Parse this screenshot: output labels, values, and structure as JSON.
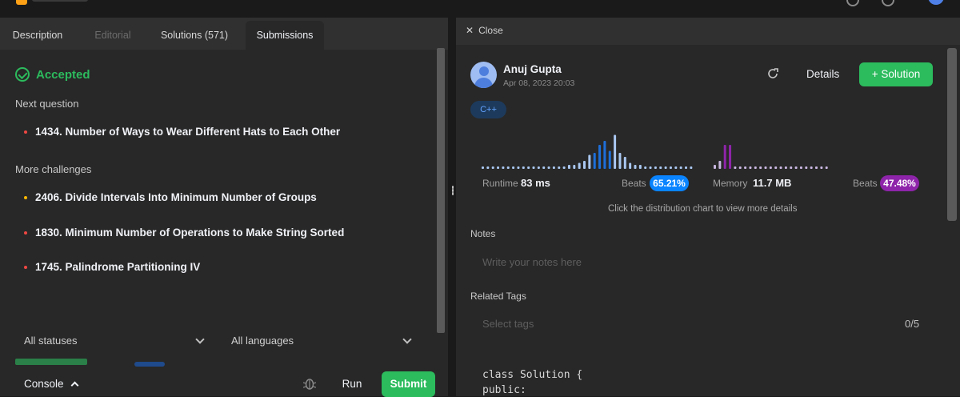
{
  "tabs": [
    {
      "label": "Description"
    },
    {
      "label": "Editorial"
    },
    {
      "label": "Solutions (571)"
    },
    {
      "label": "Submissions"
    }
  ],
  "result": {
    "status": "Accepted"
  },
  "next_question": {
    "title": "Next question",
    "item": {
      "label": "1434. Number of Ways to Wear Different Hats to Each Other",
      "color": "#ef4743"
    }
  },
  "more_challenges": {
    "title": "More challenges",
    "items": [
      {
        "label": "2406. Divide Intervals Into Minimum Number of Groups",
        "color": "#ffb800"
      },
      {
        "label": "1830. Minimum Number of Operations to Make String Sorted",
        "color": "#ef4743"
      },
      {
        "label": "1745. Palindrome Partitioning IV",
        "color": "#ef4743"
      }
    ]
  },
  "filters": {
    "status": "All statuses",
    "language": "All languages"
  },
  "console": {
    "label": "Console",
    "run": "Run",
    "submit": "Submit"
  },
  "detail": {
    "close": "Close",
    "user": "Anuj Gupta",
    "date": "Apr 08, 2023 20:03",
    "details_label": "Details",
    "solution_label": "Solution",
    "language": "C++",
    "runtime": {
      "label": "Runtime",
      "value": "83 ms",
      "beats_label": "Beats",
      "beats": "65.21%"
    },
    "memory": {
      "label": "Memory",
      "value": "11.7 MB",
      "beats_label": "Beats",
      "beats": "47.48%"
    },
    "hint": "Click the distribution chart to view more details",
    "notes_title": "Notes",
    "notes_placeholder": "Write your notes here",
    "tags_title": "Related Tags",
    "tags_placeholder": "Select tags",
    "tags_count": "0/5",
    "code": [
      "class Solution {",
      "public:"
    ]
  },
  "colors": {
    "accent_green": "#2cbb5d",
    "runtime_blue": "#0a84ff",
    "memory_purple": "#8e24aa"
  },
  "chart_data": [
    {
      "type": "bar",
      "title": "",
      "values": [
        1,
        1,
        1,
        1,
        1,
        1,
        1,
        1,
        1,
        1,
        1,
        1,
        1,
        1,
        1,
        1,
        1,
        2,
        2,
        3,
        4,
        7,
        8,
        12,
        14,
        9,
        17,
        8,
        6,
        3,
        2,
        2,
        1,
        1,
        1,
        1,
        1,
        1,
        1,
        1,
        1,
        1
      ],
      "highlight_range": [
        22,
        25
      ],
      "color": "#a9c7f0",
      "highlight_color": "#1e6fd9"
    },
    {
      "type": "bar",
      "title": "",
      "values": [
        2,
        4,
        12,
        12,
        1,
        1,
        1,
        1,
        1,
        1,
        1,
        1,
        1,
        1,
        1,
        1,
        1,
        1,
        1,
        1,
        1,
        1,
        1
      ],
      "highlight_range": [
        2,
        3
      ],
      "color": "#c8b6e0",
      "highlight_color": "#8e24aa"
    }
  ]
}
